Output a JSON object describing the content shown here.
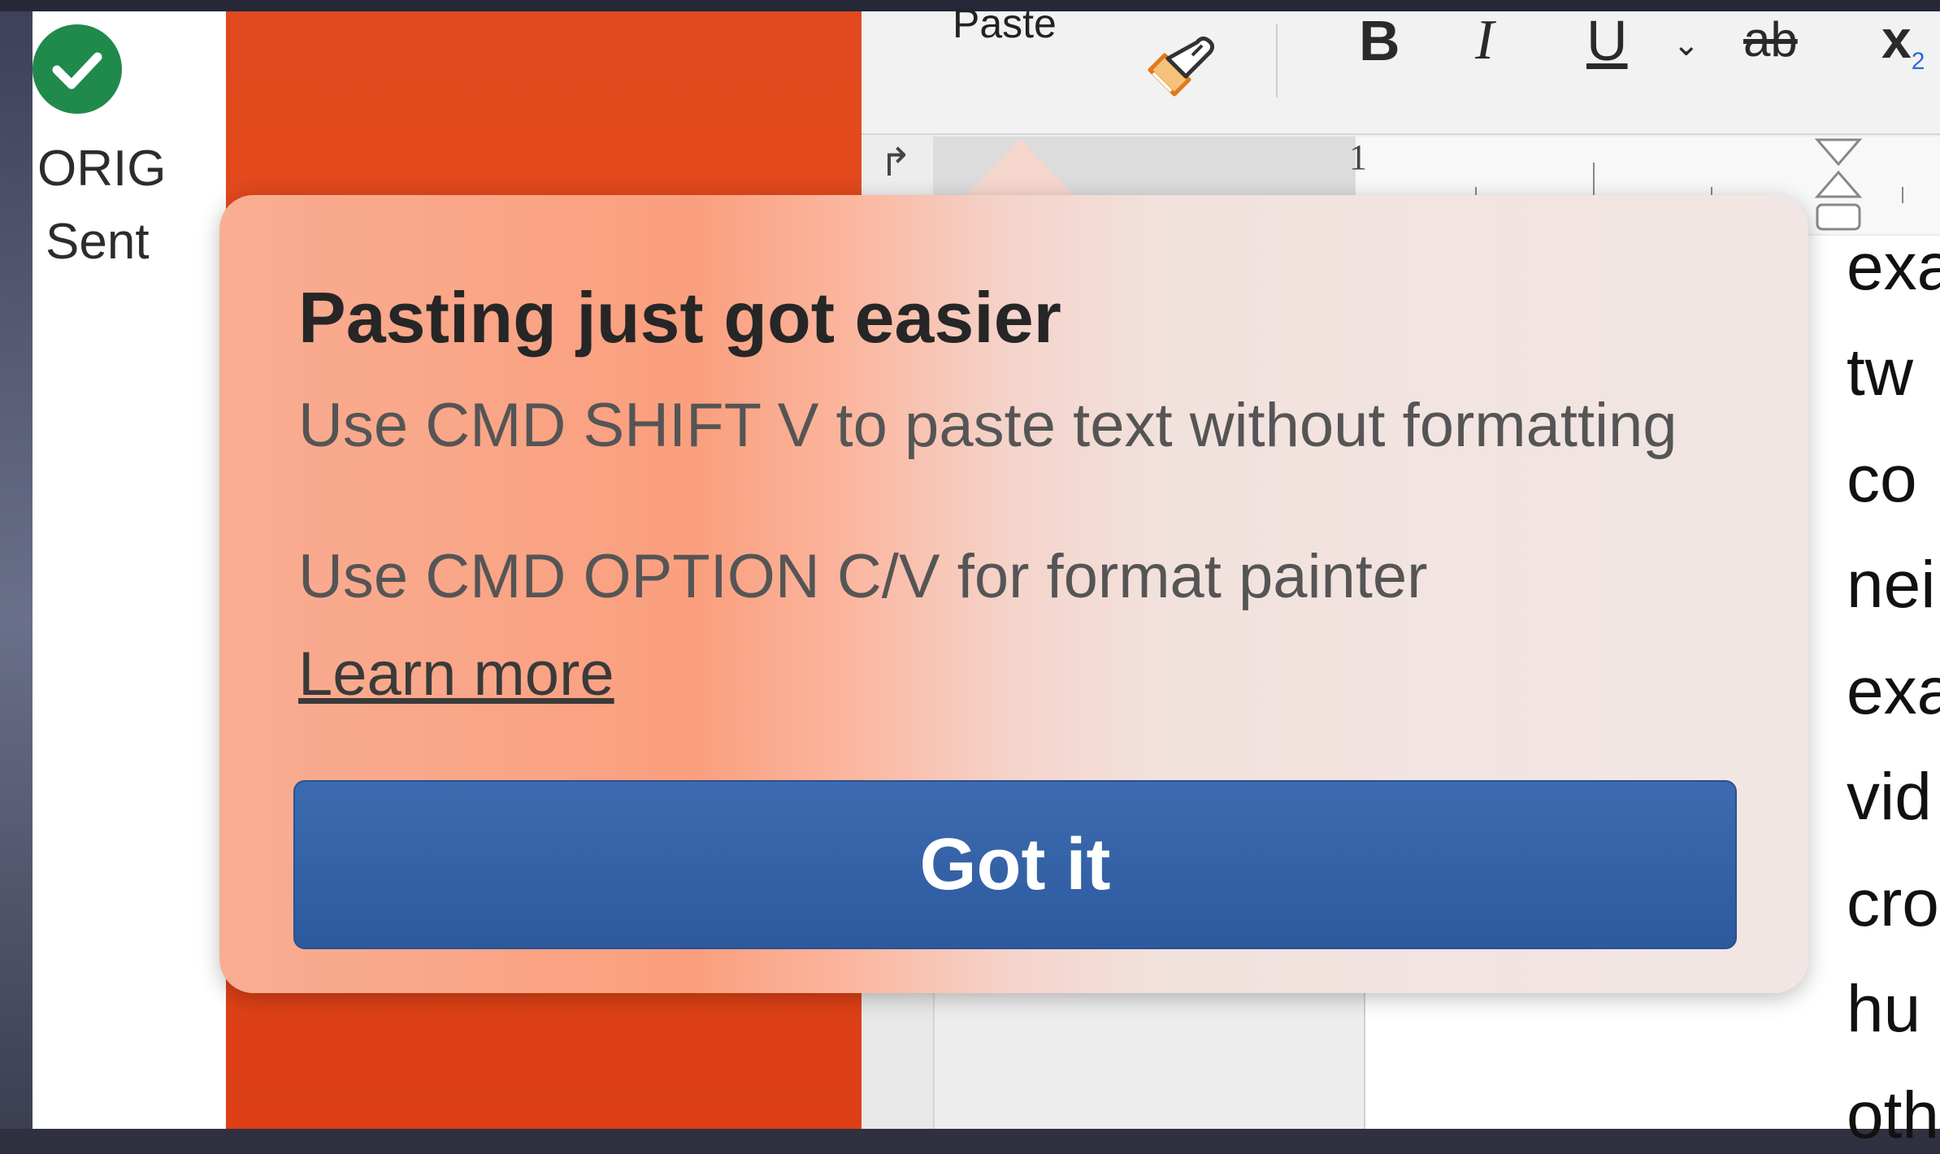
{
  "left_panel": {
    "status_label": "ORIG",
    "folder_label": "Sent",
    "status_color": "#1f8a4c"
  },
  "toolbar": {
    "paste_label": "Paste",
    "bold_label": "B",
    "italic_label": "I",
    "underline_label": "U",
    "strikethrough_label": "ab",
    "subscript_label": "x",
    "subscript_index": "2",
    "icons": [
      "format-painter-icon",
      "chevron-down-icon"
    ]
  },
  "ruler": {
    "number": "1"
  },
  "document": {
    "lines": [
      "exa",
      "tw",
      "co",
      "nei",
      "exa",
      "vid",
      "cro",
      "hu",
      "oth"
    ]
  },
  "popover": {
    "title": "Pasting just got easier",
    "line1": "Use CMD SHIFT V to paste text without formatting",
    "line2": "Use CMD OPTION C/V for format painter",
    "link_label": "Learn more",
    "button_label": "Got it",
    "button_color": "#2d5a9e"
  }
}
